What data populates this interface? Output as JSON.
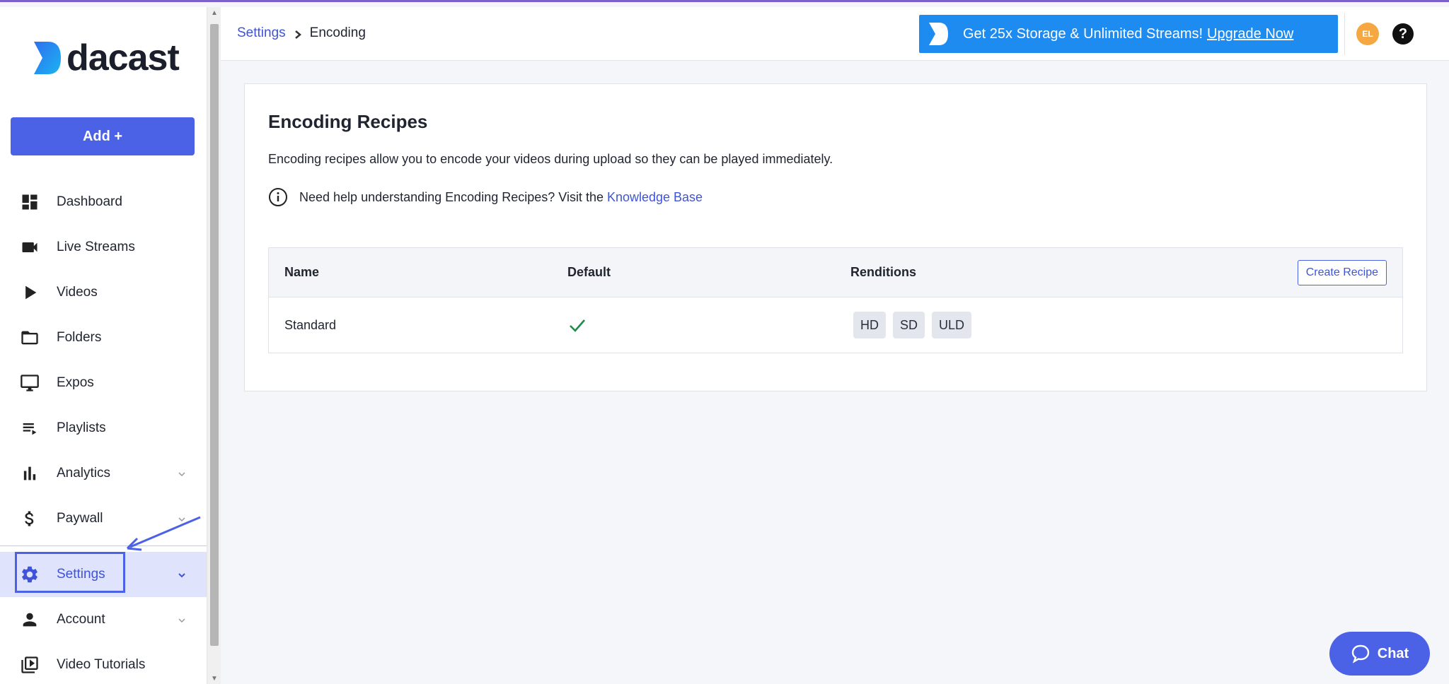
{
  "brand": {
    "name": "dacast"
  },
  "sidebar": {
    "add_label": "Add +",
    "items": [
      {
        "label": "Dashboard",
        "icon": "dashboard-icon"
      },
      {
        "label": "Live Streams",
        "icon": "video-camera-icon"
      },
      {
        "label": "Videos",
        "icon": "play-icon"
      },
      {
        "label": "Folders",
        "icon": "folder-icon"
      },
      {
        "label": "Expos",
        "icon": "monitor-icon"
      },
      {
        "label": "Playlists",
        "icon": "playlist-icon"
      },
      {
        "label": "Analytics",
        "icon": "bar-chart-icon"
      },
      {
        "label": "Paywall",
        "icon": "dollar-icon"
      },
      {
        "label": "Settings",
        "icon": "gear-icon"
      },
      {
        "label": "Account",
        "icon": "person-icon"
      },
      {
        "label": "Video Tutorials",
        "icon": "video-library-icon"
      }
    ]
  },
  "header": {
    "breadcrumb": {
      "parent": "Settings",
      "current": "Encoding"
    },
    "promo": {
      "text": "Get 25x Storage & Unlimited Streams!",
      "link": "Upgrade Now"
    },
    "avatar_initials": "EL",
    "help_symbol": "?"
  },
  "main": {
    "title": "Encoding Recipes",
    "description": "Encoding recipes allow you to encode your videos during upload so they can be played immediately.",
    "help_text": "Need help understanding Encoding Recipes? Visit the",
    "help_link": "Knowledge Base",
    "table": {
      "columns": [
        "Name",
        "Default",
        "Renditions"
      ],
      "create_label": "Create Recipe",
      "rows": [
        {
          "name": "Standard",
          "default": true,
          "renditions": [
            "HD",
            "SD",
            "ULD"
          ]
        }
      ]
    }
  },
  "chat_label": "Chat",
  "colors": {
    "accent": "#4b61e6",
    "promo": "#1e8bf0",
    "avatar": "#f5a742",
    "check": "#1f8a4c"
  }
}
